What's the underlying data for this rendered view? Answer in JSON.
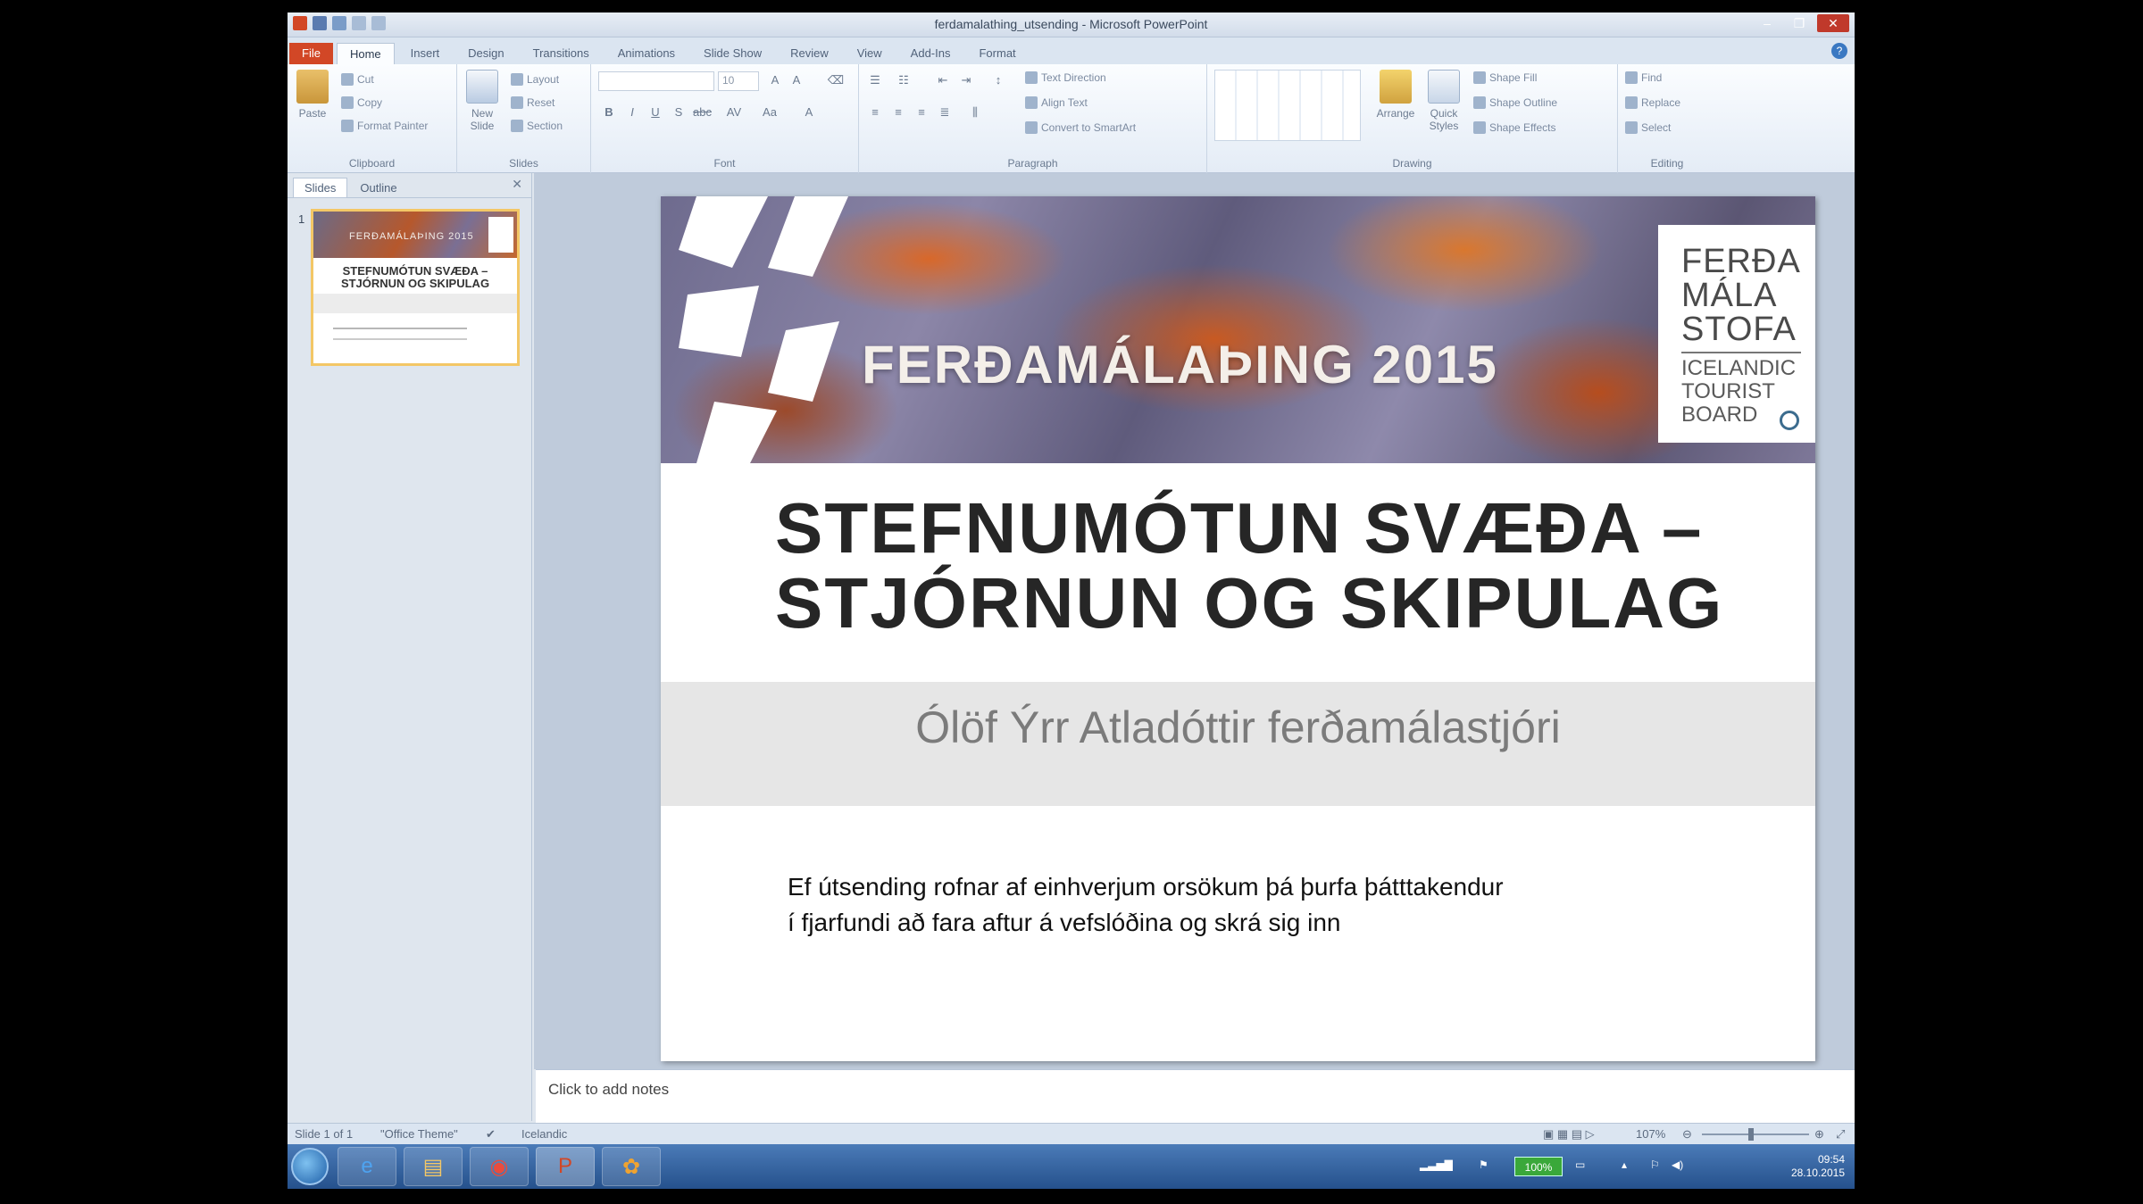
{
  "window": {
    "title": "ferdamalathing_utsending - Microsoft PowerPoint",
    "min": "‒",
    "max": "❐",
    "close": "✕"
  },
  "ribbon_tabs": [
    "File",
    "Home",
    "Insert",
    "Design",
    "Transitions",
    "Animations",
    "Slide Show",
    "Review",
    "View",
    "Add-Ins",
    "Format"
  ],
  "ribbon": {
    "clipboard": {
      "paste": "Paste",
      "cut": "Cut",
      "copy": "Copy",
      "format_painter": "Format Painter",
      "label": "Clipboard"
    },
    "slides": {
      "new_slide": "New Slide",
      "layout": "Layout",
      "reset": "Reset",
      "section": "Section",
      "label": "Slides"
    },
    "font": {
      "font_size": "10",
      "label": "Font"
    },
    "paragraph": {
      "text_direction": "Text Direction",
      "align_text": "Align Text",
      "convert_smartart": "Convert to SmartArt",
      "label": "Paragraph"
    },
    "drawing": {
      "arrange": "Arrange",
      "quick_styles": "Quick Styles",
      "shape_fill": "Shape Fill",
      "shape_outline": "Shape Outline",
      "shape_effects": "Shape Effects",
      "label": "Drawing"
    },
    "editing": {
      "find": "Find",
      "replace": "Replace",
      "select": "Select",
      "label": "Editing"
    }
  },
  "left_panel": {
    "tabs": [
      "Slides",
      "Outline"
    ],
    "slide_number": "1",
    "thumb_banner": "FERÐAMÁLAÞING 2015",
    "thumb_title": "STEFNUMÓTUN SVÆÐA – STJÓRNUN OG SKIPULAG"
  },
  "slide": {
    "banner_title": "FERÐAMÁLAÞING 2015",
    "logo_top": [
      "FERÐA",
      "MÁLA",
      "STOFA"
    ],
    "logo_bottom": [
      "ICELANDIC",
      "TOURIST",
      "BOARD"
    ],
    "title_line1": "STEFNUMÓTUN SVÆÐA –",
    "title_line2": "STJÓRNUN OG SKIPULAG",
    "subtitle": "Ólöf Ýrr Atladóttir ferðamálastjóri",
    "body_line1": "Ef útsending rofnar af einhverjum orsökum þá þurfa þátttakendur",
    "body_line2": "í fjarfundi að fara  aftur á vefslóðina og skrá sig inn"
  },
  "notes_placeholder": "Click to add notes",
  "status": {
    "slide_info": "Slide 1 of 1",
    "theme": "\"Office Theme\"",
    "language": "Icelandic",
    "zoom": "107%"
  },
  "tray": {
    "battery": "100%",
    "time": "09:54",
    "date": "28.10.2015"
  }
}
